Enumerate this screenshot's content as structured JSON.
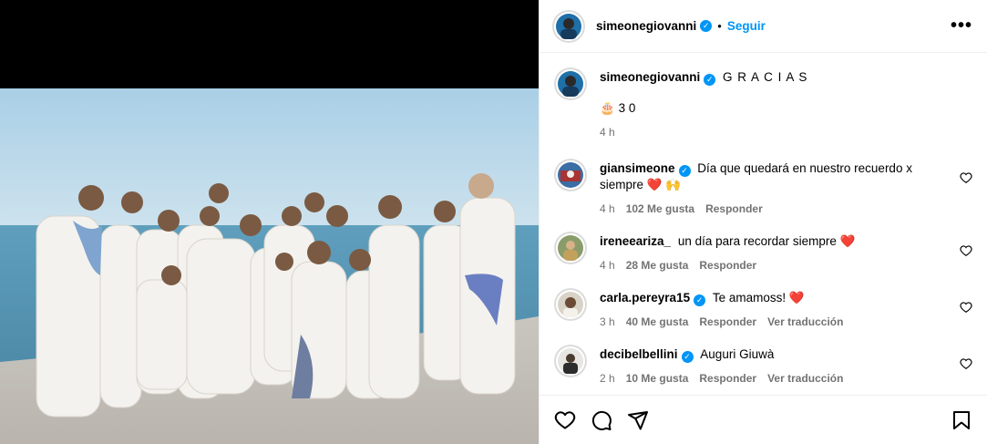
{
  "post": {
    "author": "simeonegiovanni",
    "follow_label": "Seguir",
    "dot": "•",
    "more": "•••",
    "caption": "G R A C I A S",
    "caption_line2_emoji": "🎂",
    "caption_line2_text": "3 0",
    "caption_time": "4 h"
  },
  "comments": [
    {
      "user": "giansimeone",
      "verified": true,
      "text": "Día que quedará en nuestro recuerdo x siempre ❤️ 🙌",
      "time": "4 h",
      "likes": "102 Me gusta",
      "reply": "Responder",
      "translate": ""
    },
    {
      "user": "ireneeariza_",
      "verified": false,
      "text": "un día para recordar siempre ❤️",
      "time": "4 h",
      "likes": "28 Me gusta",
      "reply": "Responder",
      "translate": ""
    },
    {
      "user": "carla.pereyra15",
      "verified": true,
      "text": "Te amamoss! ❤️",
      "time": "3 h",
      "likes": "40 Me gusta",
      "reply": "Responder",
      "translate": "Ver traducción"
    },
    {
      "user": "decibelbellini",
      "verified": true,
      "text": "Auguri Giuwà",
      "time": "2 h",
      "likes": "10 Me gusta",
      "reply": "Responder",
      "translate": "Ver traducción"
    }
  ],
  "icons": {
    "verified": "verified-badge-icon",
    "like": "heart-icon",
    "comment": "comment-icon",
    "share": "share-icon",
    "save": "bookmark-icon"
  },
  "colors": {
    "accent": "#0095f6",
    "muted": "#737373",
    "heart": "#ed4956"
  }
}
